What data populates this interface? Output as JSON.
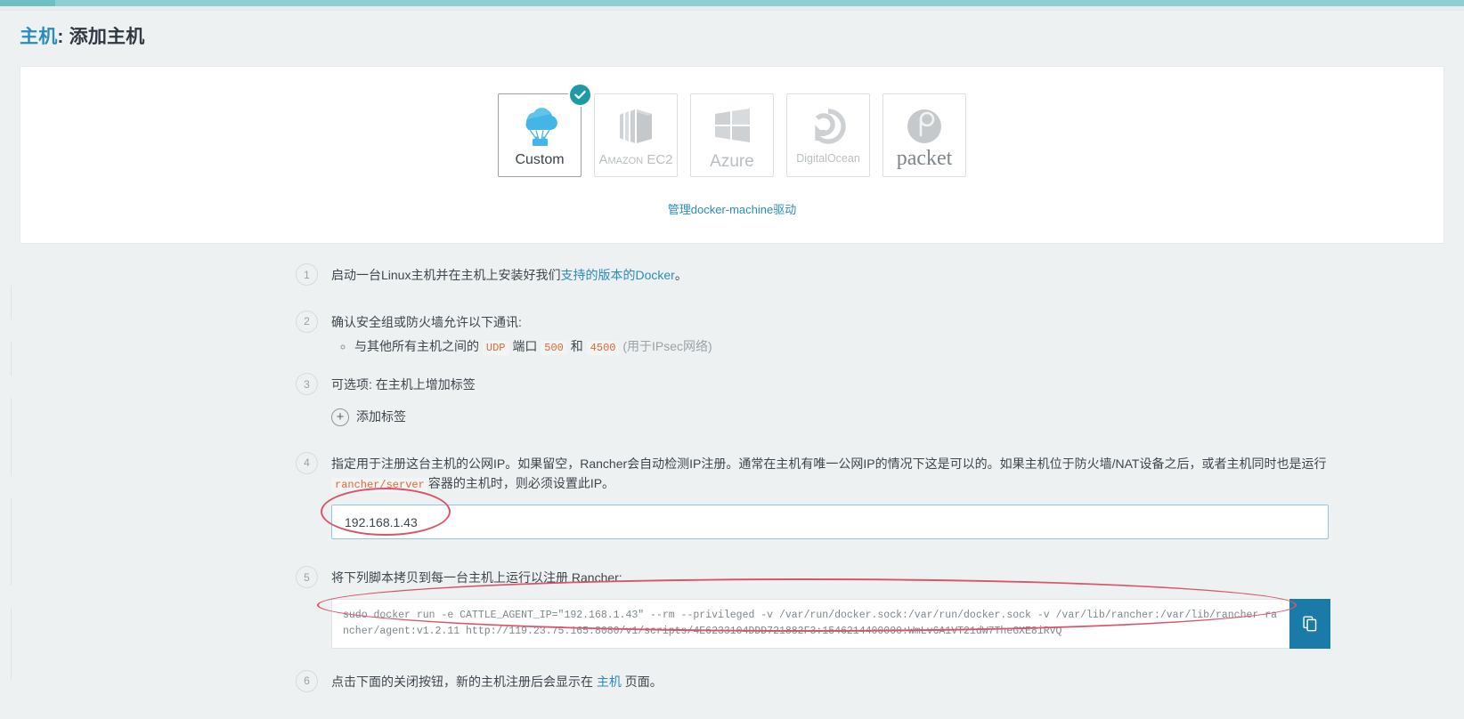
{
  "header": {
    "title_link": "主机",
    "title_rest": ": 添加主机"
  },
  "drivers": {
    "items": [
      {
        "name": "custom",
        "label": "Custom",
        "icon": "cloud-parachute-icon",
        "selected": true
      },
      {
        "name": "amazon-ec2",
        "label": "Amazon EC2",
        "icon": "aws-cube-icon",
        "selected": false
      },
      {
        "name": "azure",
        "label": "Azure",
        "icon": "windows-icon",
        "selected": false
      },
      {
        "name": "digitalocean",
        "label": "DigitalOcean",
        "icon": "digitalocean-icon",
        "selected": false
      },
      {
        "name": "packet",
        "label": "packet",
        "icon": "packet-p-icon",
        "selected": false
      }
    ],
    "manage_link": "管理docker-machine驱动",
    "selected_badge": "check-icon"
  },
  "steps": {
    "n1": "1",
    "n2": "2",
    "n3": "3",
    "n4": "4",
    "n5": "5",
    "n6": "6",
    "s1": {
      "pre": "启动一台Linux主机并在主机上安装好我们",
      "link": "支持的版本的Docker",
      "post": "。"
    },
    "s2": {
      "title": "确认安全组或防火墙允许以下通讯:",
      "bullet_pre": "与其他所有主机之间的",
      "code_udp": "UDP",
      "mid": "端口",
      "code_500": "500",
      "and": "和",
      "code_4500": "4500",
      "note": "(用于IPsec网络)"
    },
    "s3": {
      "title": "可选项: 在主机上增加标签",
      "add_label": "添加标签",
      "plus": "+"
    },
    "s4": {
      "line1": "指定用于注册这台主机的公网IP。如果留空，Rancher会自动检测IP注册。通常在主机有唯一公网IP的情况下这是可以的。如果主机位于防火墙/NAT设备之后，或者主机同时也是运行",
      "code": "rancher/server",
      "line2": "容器的主机时，则必须设置此IP。",
      "input_value": "192.168.1.43",
      "input_placeholder": ""
    },
    "s5": {
      "title": "将下列脚本拷贝到每一台主机上运行以注册 Rancher:",
      "command": "sudo docker run -e CATTLE_AGENT_IP=\"192.168.1.43\"  --rm --privileged -v /var/run/docker.sock:/var/run/docker.sock -v /var/lib/rancher:/var/lib/rancher rancher/agent:v1.2.11 http://119.23.75.165:8080/v1/scripts/4E6233104DDD721882F3:1546214400000:WmLv6A1VT21dW7TheGXE8iRvQ",
      "copy_icon": "copy-icon"
    },
    "s6": {
      "pre": "点击下面的关闭按钮，新的主机注册后会显示在 ",
      "link": "主机",
      "post": " 页面。"
    }
  },
  "colors": {
    "accent_teal": "#8ed0d2",
    "link_blue": "#2a8cbe",
    "code_orange": "#e0683a",
    "copy_button": "#1a7aa8",
    "annotation_red": "#d9556a"
  }
}
